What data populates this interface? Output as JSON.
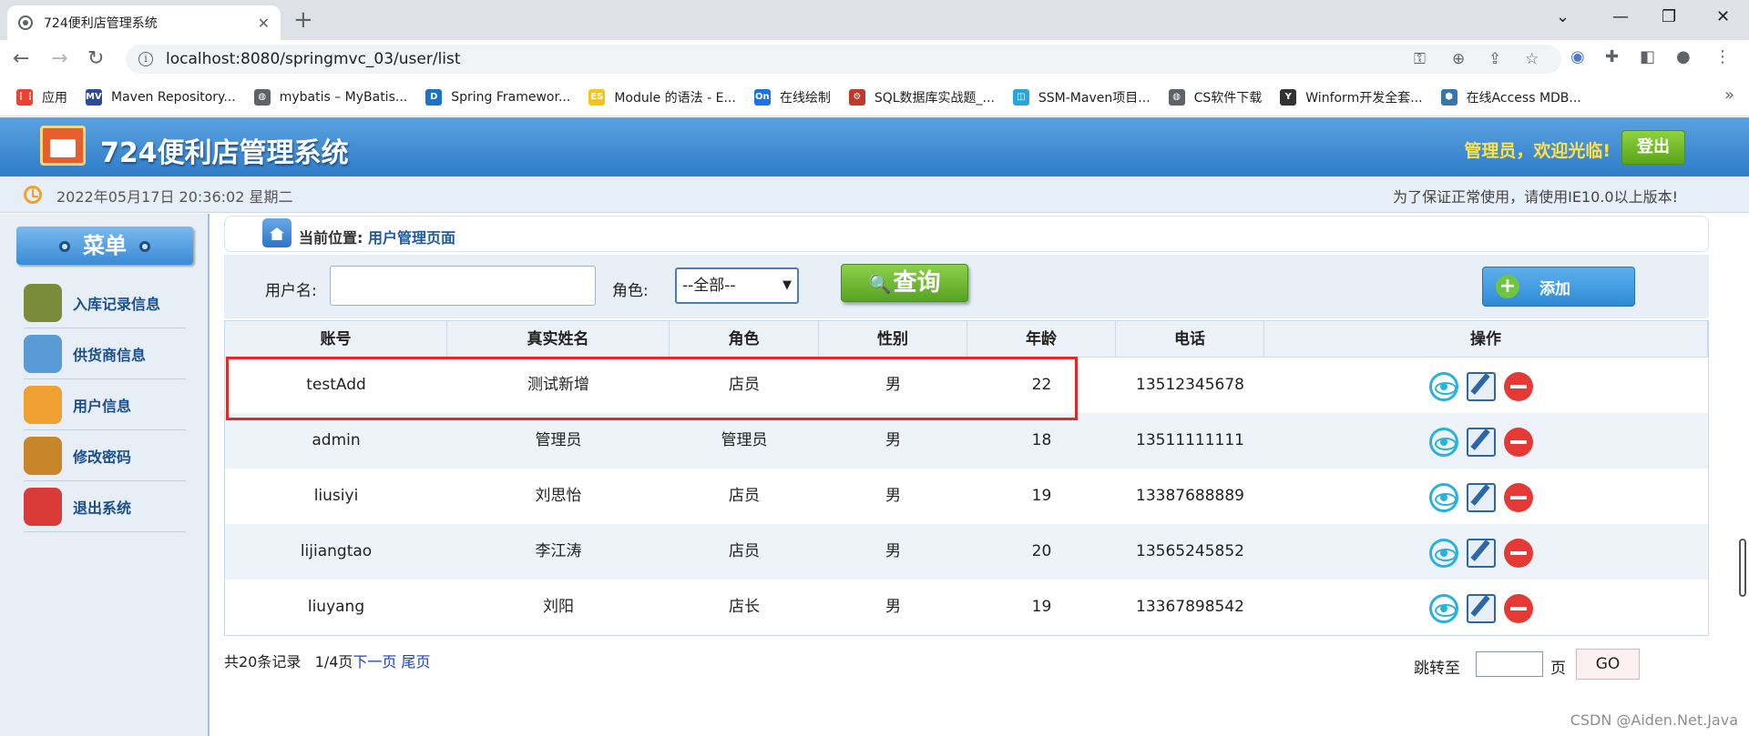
{
  "browser": {
    "tab_title": "724便利店管理系统",
    "url": "localhost:8080/springmvc_03/user/list",
    "bookmarks": [
      {
        "label": "应用",
        "icon": "apps-grid-icon",
        "color": "#ea4335"
      },
      {
        "label": "Maven Repository...",
        "icon": "maven-icon",
        "color": "#2b4a9a"
      },
      {
        "label": "mybatis – MyBatis...",
        "icon": "globe-icon",
        "color": "#5f6368"
      },
      {
        "label": "Spring Framewor...",
        "icon": "spring-d-icon",
        "color": "#1a73c8"
      },
      {
        "label": "Module 的语法 - E...",
        "icon": "es-icon",
        "color": "#f5c518"
      },
      {
        "label": "在线绘制",
        "icon": "on-icon",
        "color": "#1a73e8"
      },
      {
        "label": "SQL数据库实战题_...",
        "icon": "sql-icon",
        "color": "#c0392b"
      },
      {
        "label": "SSM-Maven项目...",
        "icon": "bilibili-icon",
        "color": "#2aa5d8"
      },
      {
        "label": "CS软件下载",
        "icon": "globe-icon",
        "color": "#5f6368"
      },
      {
        "label": "Winform开发全套...",
        "icon": "yuque-icon",
        "color": "#333333"
      },
      {
        "label": "在线Access MDB...",
        "icon": "python-icon",
        "color": "#3776ab"
      }
    ]
  },
  "header": {
    "title": "724便利店管理系统",
    "welcome": "管理员，欢迎光临!",
    "logout_label": "登出",
    "datetime": "2022年05月17日 20:36:02 星期二",
    "notice": "为了保证正常使用，请使用IE10.0以上版本!"
  },
  "sidebar": {
    "title": "菜单",
    "items": [
      {
        "label": "入库记录信息",
        "icon": "truck-icon",
        "color": "#7a8c3a"
      },
      {
        "label": "供货商信息",
        "icon": "supplier-icon",
        "color": "#5b9bd5"
      },
      {
        "label": "用户信息",
        "icon": "users-icon",
        "color": "#f0a030"
      },
      {
        "label": "修改密码",
        "icon": "tools-icon",
        "color": "#c8862a"
      },
      {
        "label": "退出系统",
        "icon": "power-icon",
        "color": "#d93a3a"
      }
    ]
  },
  "location": {
    "label": "当前位置:",
    "value": "用户管理页面"
  },
  "search": {
    "username_label": "用户名:",
    "username_value": "",
    "role_label": "角色:",
    "role_selected": "--全部--",
    "query_label": "查询",
    "add_label": "添加"
  },
  "table": {
    "headers": [
      "账号",
      "真实姓名",
      "角色",
      "性别",
      "年龄",
      "电话",
      "操作"
    ],
    "rows": [
      {
        "account": "testAdd",
        "name": "测试新增",
        "role": "店员",
        "gender": "男",
        "age": "22",
        "phone": "13512345678"
      },
      {
        "account": "admin",
        "name": "管理员",
        "role": "管理员",
        "gender": "男",
        "age": "18",
        "phone": "13511111111"
      },
      {
        "account": "liusiyi",
        "name": "刘思怡",
        "role": "店员",
        "gender": "男",
        "age": "19",
        "phone": "13387688889"
      },
      {
        "account": "lijiangtao",
        "name": "李江涛",
        "role": "店员",
        "gender": "男",
        "age": "20",
        "phone": "13565245852"
      },
      {
        "account": "liuyang",
        "name": "刘阳",
        "role": "店长",
        "gender": "男",
        "age": "19",
        "phone": "13367898542"
      }
    ]
  },
  "pager": {
    "total": "共20条记录",
    "page": "1/4页",
    "next": "下一页",
    "last": "尾页",
    "jump_label": "跳转至",
    "page_unit": "页",
    "go_label": "GO"
  },
  "watermark": "CSDN @Aiden.Net.Java",
  "colors": {
    "header_blue": "#2f7cc8",
    "welcome_yellow": "#ffe243",
    "query_green": "#58a323",
    "highlight_red": "#e02a2a",
    "link_blue": "#1a3fcf"
  }
}
